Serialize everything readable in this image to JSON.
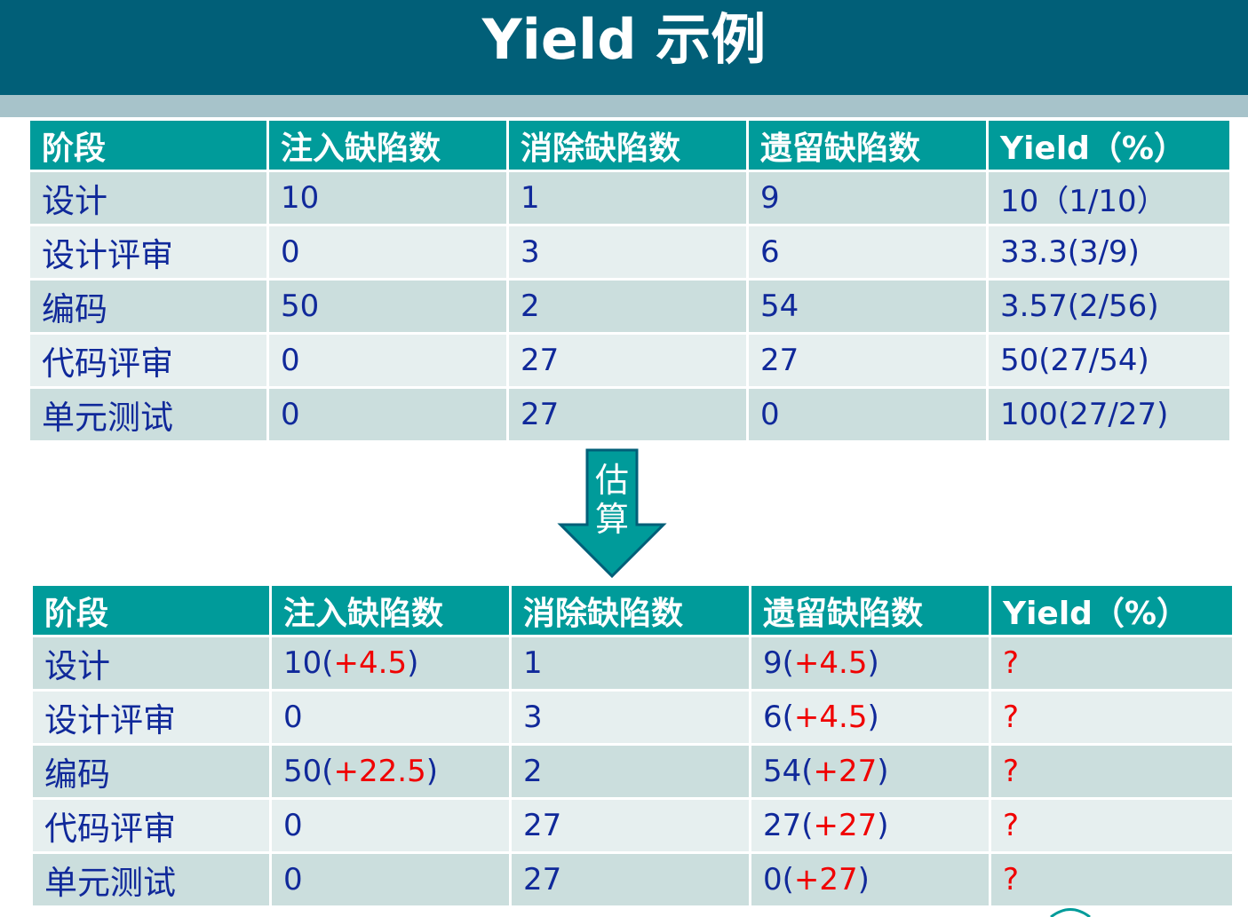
{
  "title": "Yield 示例",
  "headers": [
    "阶段",
    "注入缺陷数",
    "消除缺陷数",
    "遗留缺陷数",
    "Yield（%）"
  ],
  "table_before": [
    [
      "设计",
      "10",
      "1",
      "9",
      "10（1/10）"
    ],
    [
      "设计评审",
      "0",
      "3",
      "6",
      "33.3(3/9)"
    ],
    [
      "编码",
      "50",
      "2",
      "54",
      "3.57(2/56)"
    ],
    [
      "代码评审",
      "0",
      "27",
      "27",
      "50(27/54)"
    ],
    [
      "单元测试",
      "0",
      "27",
      "0",
      "100(27/27)"
    ]
  ],
  "arrow_label": "估算",
  "table_after": [
    [
      "设计",
      [
        [
          "10(",
          ""
        ],
        [
          "+4.5",
          "red"
        ],
        [
          ")",
          ""
        ]
      ],
      "1",
      [
        [
          "9(",
          ""
        ],
        [
          "+4.5",
          "red"
        ],
        [
          ")",
          ""
        ]
      ],
      [
        [
          "?",
          "red"
        ]
      ]
    ],
    [
      "设计评审",
      "0",
      "3",
      [
        [
          "6(",
          ""
        ],
        [
          "+4.5",
          "red"
        ],
        [
          ")",
          ""
        ]
      ],
      [
        [
          "?",
          "red"
        ]
      ]
    ],
    [
      "编码",
      [
        [
          "50(",
          ""
        ],
        [
          "+22.5",
          "red"
        ],
        [
          ")",
          ""
        ]
      ],
      "2",
      [
        [
          "54(",
          ""
        ],
        [
          "+27",
          "red"
        ],
        [
          ")",
          ""
        ]
      ],
      [
        [
          "?",
          "red"
        ]
      ]
    ],
    [
      "代码评审",
      "0",
      "27",
      [
        [
          "27(",
          ""
        ],
        [
          "+27",
          "red"
        ],
        [
          ")",
          ""
        ]
      ],
      [
        [
          "?",
          "red"
        ]
      ]
    ],
    [
      "单元测试",
      "0",
      "27",
      [
        [
          "0(",
          ""
        ],
        [
          "+27",
          "red"
        ],
        [
          ")",
          ""
        ]
      ],
      [
        [
          "?",
          "red"
        ]
      ]
    ]
  ],
  "colors": {
    "title_bg": "#015f78",
    "header_bg": "#009b9a",
    "row_odd": "#cbdedd",
    "row_even": "#e6efef",
    "cell_text": "#10299a",
    "highlight": "#f00000"
  }
}
